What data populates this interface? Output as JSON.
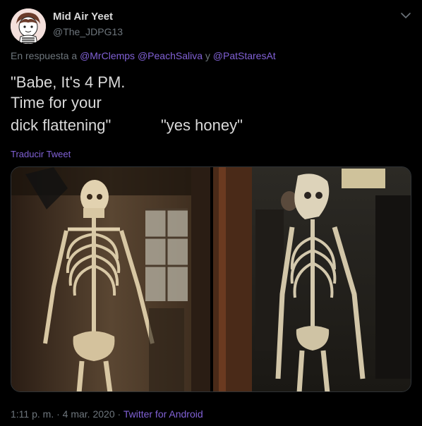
{
  "author": {
    "display_name": "Mid Air Yeet",
    "handle": "@The_JDPG13"
  },
  "reply": {
    "prefix": "En respuesta a",
    "mentions": [
      "@MrClemps",
      "@PeachSaliva",
      "@PatStaresAt"
    ],
    "joiner": "y"
  },
  "tweet": {
    "line1": "\"Babe, It's 4 PM.",
    "line2": "Time for your",
    "line3_left": "dick flattening\"",
    "line3_right": "\"yes honey\""
  },
  "translate_label": "Traducir Tweet",
  "footer": {
    "time": "1:11 p. m.",
    "date": "4 mar. 2020",
    "source": "Twitter for Android",
    "separator": "·"
  },
  "colors": {
    "background": "#000000",
    "text": "#d9d9d9",
    "muted": "#6e767d",
    "accent": "#8161d6"
  },
  "icons": {
    "menu": "chevron-down-icon"
  }
}
